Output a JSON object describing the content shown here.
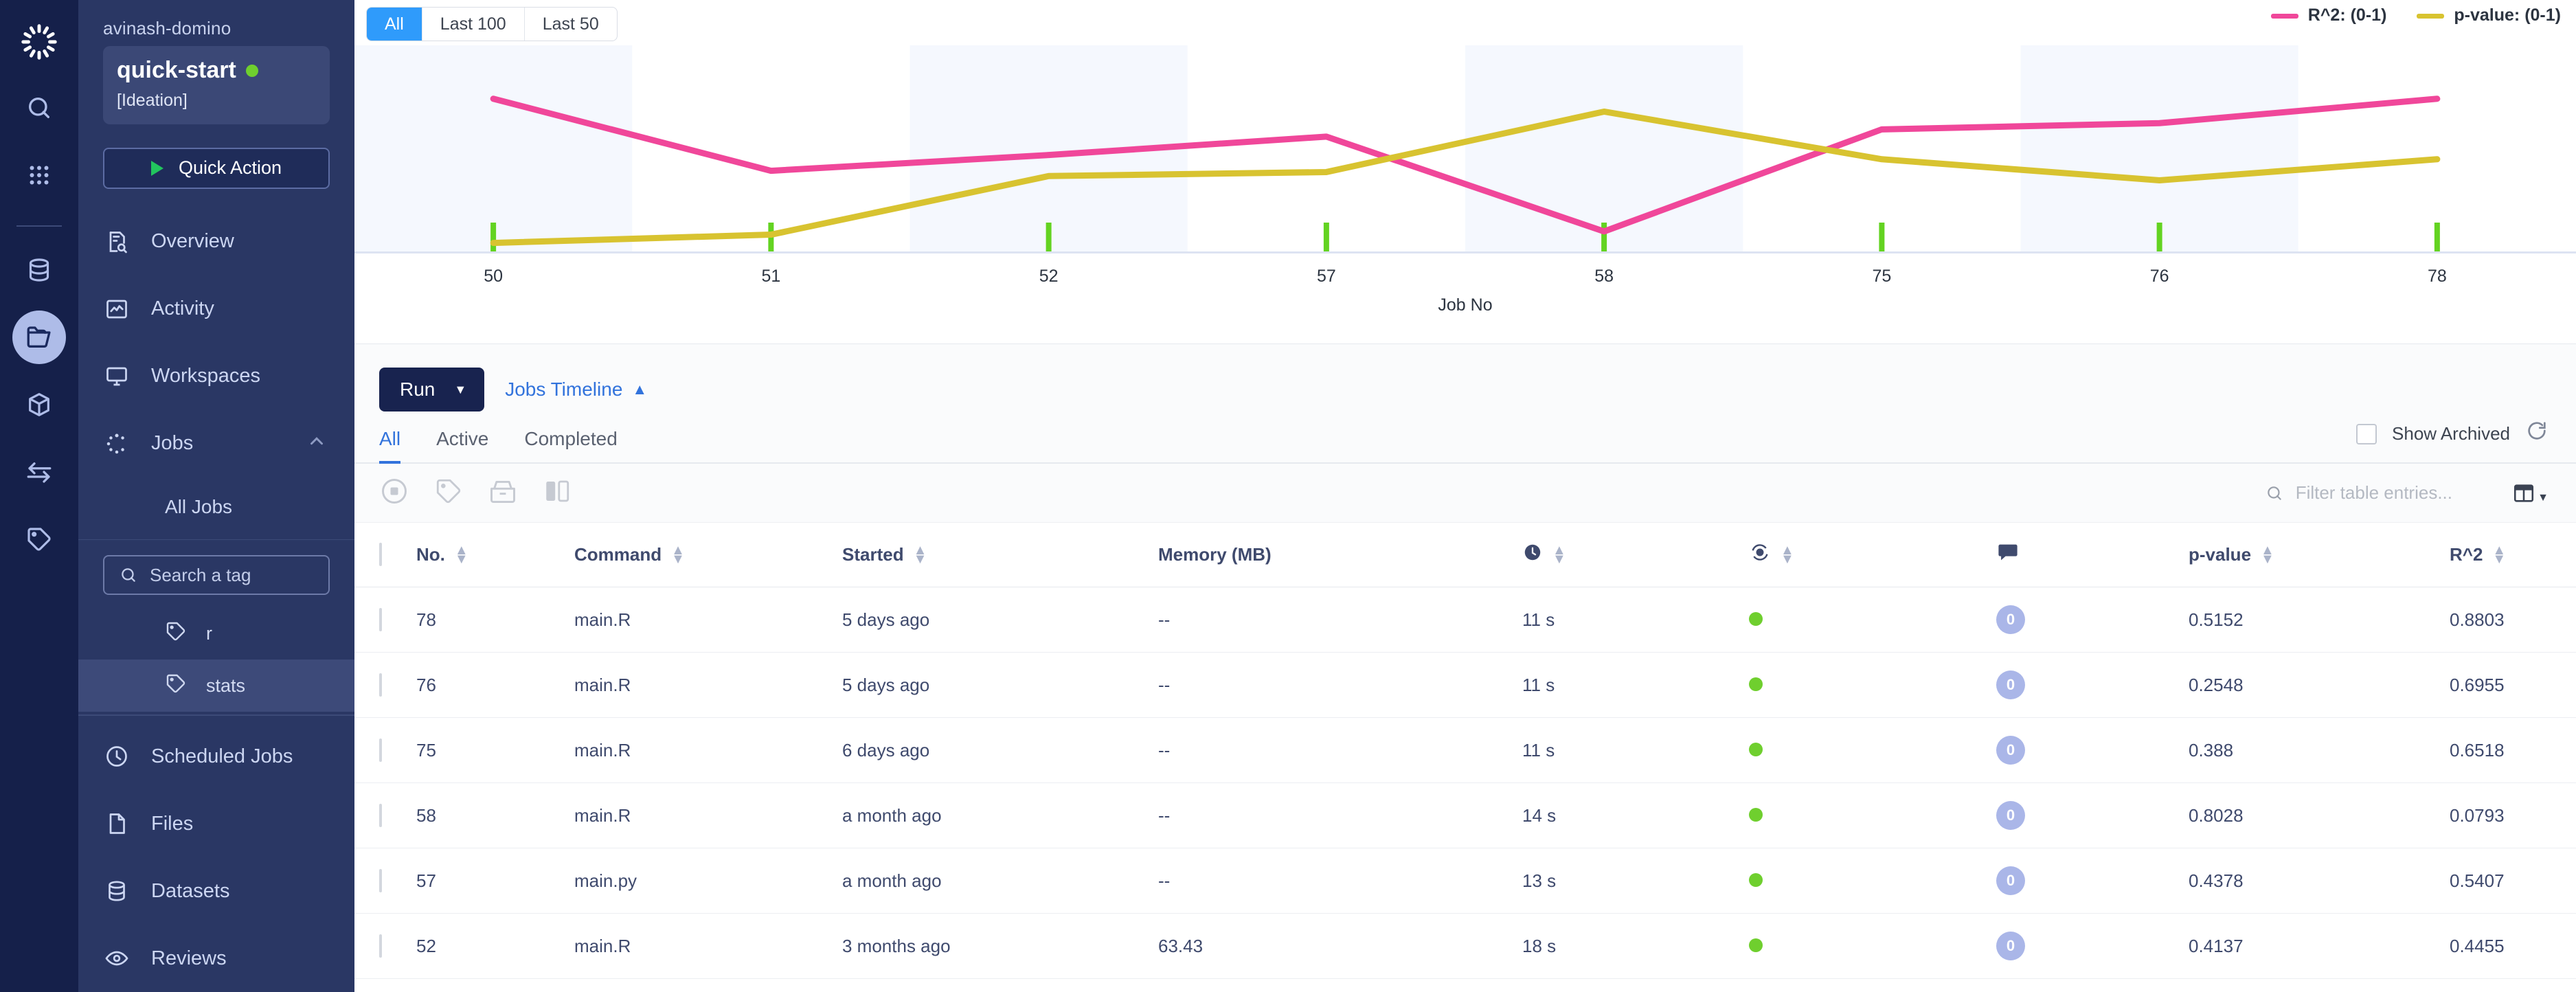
{
  "rail": {
    "logo": "domino-logo-icon",
    "items": [
      {
        "name": "search-icon"
      },
      {
        "name": "apps-grid-icon"
      },
      {
        "name": "database-icon"
      },
      {
        "name": "folder-open-icon",
        "active": true
      },
      {
        "name": "cube-icon"
      },
      {
        "name": "transfer-arrows-icon"
      },
      {
        "name": "tag-icon"
      }
    ]
  },
  "sidebar": {
    "org": "avinash-domino",
    "project": "quick-start",
    "stage": "[Ideation]",
    "quick_action": "Quick Action",
    "nav": [
      {
        "label": "Overview",
        "icon": "overview-icon"
      },
      {
        "label": "Activity",
        "icon": "activity-chart-icon"
      },
      {
        "label": "Workspaces",
        "icon": "monitor-icon"
      },
      {
        "label": "Jobs",
        "icon": "jobs-spinner-icon",
        "expanded": true
      }
    ],
    "jobs_sub": "All Jobs",
    "tag_search_placeholder": "Search a tag",
    "tags": [
      {
        "label": "r",
        "active": false
      },
      {
        "label": "stats",
        "active": true
      }
    ],
    "nav_lower": [
      {
        "label": "Scheduled Jobs",
        "icon": "clock-icon"
      },
      {
        "label": "Files",
        "icon": "file-icon"
      },
      {
        "label": "Datasets",
        "icon": "database-icon"
      },
      {
        "label": "Reviews",
        "icon": "eye-icon"
      }
    ]
  },
  "chart_panel": {
    "range_buttons": [
      {
        "label": "All",
        "selected": true
      },
      {
        "label": "Last 100",
        "selected": false
      },
      {
        "label": "Last 50",
        "selected": false
      }
    ]
  },
  "chart_data": {
    "type": "line",
    "title": "",
    "xlabel": "Job No",
    "ylabel": "",
    "grid": false,
    "legend_position": "top-right",
    "categories": [
      "50",
      "51",
      "52",
      "57",
      "58",
      "75",
      "76",
      "78"
    ],
    "ylim": [
      0,
      1
    ],
    "series": [
      {
        "name": "R^2: (0-1)",
        "color": "#f0479a",
        "values": [
          0.8803,
          0.4455,
          0.5407,
          0.6518,
          0.0793,
          0.6955,
          0.733,
          0.8803
        ]
      },
      {
        "name": "p-value: (0-1)",
        "color": "#d8c330",
        "values": [
          0.01,
          0.06,
          0.4137,
          0.4378,
          0.8028,
          0.5152,
          0.388,
          0.5152
        ]
      }
    ],
    "legend": [
      "R^2: (0-1)",
      "p-value: (0-1)"
    ],
    "tick_marker_color": "#63d321"
  },
  "jobs": {
    "run_button": "Run",
    "run_caret": "▼",
    "timeline_link": "Jobs Timeline",
    "timeline_caret": "▲",
    "tabs": [
      {
        "label": "All",
        "selected": true
      },
      {
        "label": "Active",
        "selected": false
      },
      {
        "label": "Completed",
        "selected": false
      }
    ],
    "show_archived_label": "Show Archived",
    "show_archived_checked": false,
    "toolbar_icons": [
      "stop-icon",
      "tag-icon",
      "archive-icon",
      "compare-columns-icon"
    ],
    "filter_placeholder": "Filter table entries...",
    "columns_icon": "table-columns-icon"
  },
  "table": {
    "headers": [
      {
        "label": "",
        "key": "checkbox",
        "sortable": false,
        "icon": ""
      },
      {
        "label": "No.",
        "key": "no",
        "sortable": true,
        "icon": ""
      },
      {
        "label": "Command",
        "key": "command",
        "sortable": true,
        "icon": ""
      },
      {
        "label": "Started",
        "key": "started",
        "sortable": true,
        "icon": ""
      },
      {
        "label": "Memory (MB)",
        "key": "memory",
        "sortable": false,
        "icon": ""
      },
      {
        "label": "",
        "key": "duration",
        "sortable": true,
        "icon": "clock-icon"
      },
      {
        "label": "",
        "key": "status",
        "sortable": true,
        "icon": "status-gear-icon"
      },
      {
        "label": "",
        "key": "comments",
        "sortable": false,
        "icon": "comment-icon"
      },
      {
        "label": "p-value",
        "key": "pvalue",
        "sortable": true,
        "icon": ""
      },
      {
        "label": "R^2",
        "key": "r2",
        "sortable": true,
        "icon": ""
      }
    ],
    "rows": [
      {
        "no": "78",
        "command": "main.R",
        "started": "5 days ago",
        "memory": "--",
        "duration": "11 s",
        "status": "green",
        "comments": "0",
        "pvalue": "0.5152",
        "r2": "0.8803"
      },
      {
        "no": "76",
        "command": "main.R",
        "started": "5 days ago",
        "memory": "--",
        "duration": "11 s",
        "status": "green",
        "comments": "0",
        "pvalue": "0.2548",
        "r2": "0.6955"
      },
      {
        "no": "75",
        "command": "main.R",
        "started": "6 days ago",
        "memory": "--",
        "duration": "11 s",
        "status": "green",
        "comments": "0",
        "pvalue": "0.388",
        "r2": "0.6518"
      },
      {
        "no": "58",
        "command": "main.R",
        "started": "a month ago",
        "memory": "--",
        "duration": "14 s",
        "status": "green",
        "comments": "0",
        "pvalue": "0.8028",
        "r2": "0.0793"
      },
      {
        "no": "57",
        "command": "main.py",
        "started": "a month ago",
        "memory": "--",
        "duration": "13 s",
        "status": "green",
        "comments": "0",
        "pvalue": "0.4378",
        "r2": "0.5407"
      },
      {
        "no": "52",
        "command": "main.R",
        "started": "3 months ago",
        "memory": "63.43",
        "duration": "18 s",
        "status": "green",
        "comments": "0",
        "pvalue": "0.4137",
        "r2": "0.4455"
      }
    ]
  },
  "colors": {
    "rail_bg": "#15204a",
    "sidebar_bg": "#2a3764",
    "accent_blue": "#3273dc",
    "selected_blue": "#2f9bfb",
    "pink": "#f0479a",
    "yellow": "#d8c330",
    "green": "#6fcf2e",
    "navy_button": "#18234f"
  }
}
